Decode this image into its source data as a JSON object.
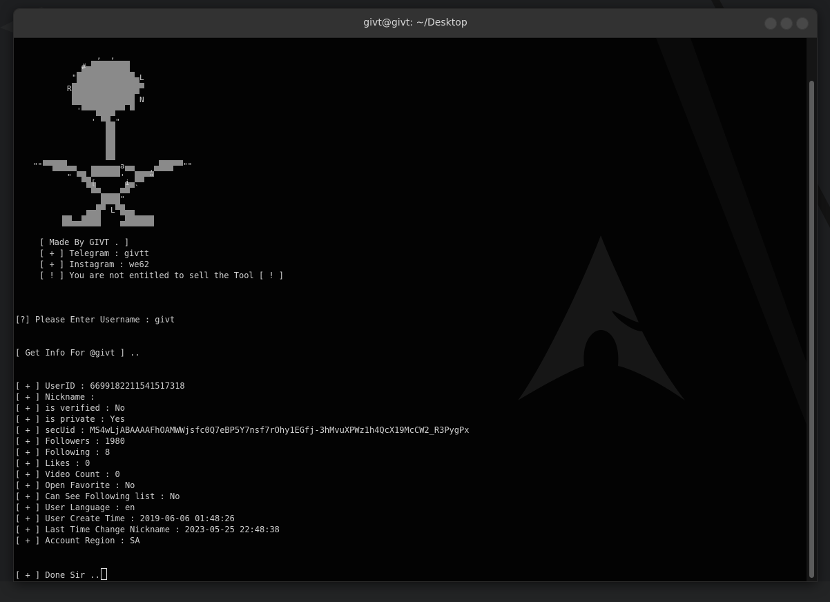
{
  "window": {
    "title": "givt@givt: ~/Desktop"
  },
  "banner": {
    "made_by": "[ Made By GIVT . ]",
    "telegram": "[ + ] Telegram : givtt",
    "instagram": "[ + ] Instagram : we62",
    "warning": "[ ! ] You are not entitled to sell the Tool [ ! ]",
    "ascii_chars": [
      ",",
      ",",
      "#",
      "\"",
      "L",
      "R",
      "N",
      "'",
      "'",
      "\"",
      "\"\"",
      "a",
      ",",
      "\"\"",
      "\"",
      "[",
      "'",
      "i",
      "\"",
      "`",
      "\"",
      "L"
    ]
  },
  "prompt": {
    "question": "[?] Please Enter Username : givt",
    "getting": "[ Get Info For @givt ] .."
  },
  "results": [
    "[ + ] UserID : 6699182211541517318",
    "[ + ] Nickname :",
    "[ + ] is verified : No",
    "[ + ] is private : Yes",
    "[ + ] secUid : MS4wLjABAAAAFhOAMWWjsfc0Q7eBP5Y7nsf7rOhy1EGfj-3hMvuXPWz1h4QcX19McCW2_R3PygPx",
    "[ + ] Followers : 1980",
    "[ + ] Following : 8",
    "[ + ] Likes : 0",
    "[ + ] Video Count : 0",
    "[ + ] Open Favorite : No",
    "[ + ] Can See Following list : No",
    "[ + ] User Language : en",
    "[ + ] User Create Time : 2019-06-06 01:48:26",
    "[ + ] Last Time Change Nickname : 2023-05-25 22:48:38",
    "[ + ] Account Region : SA"
  ],
  "done": "[ + ] Done Sir ..",
  "colors": {
    "terminal_bg": "#030303",
    "text": "#d0d0d0",
    "ascii_block": "#8a8a8a",
    "titlebar": "#323232"
  }
}
